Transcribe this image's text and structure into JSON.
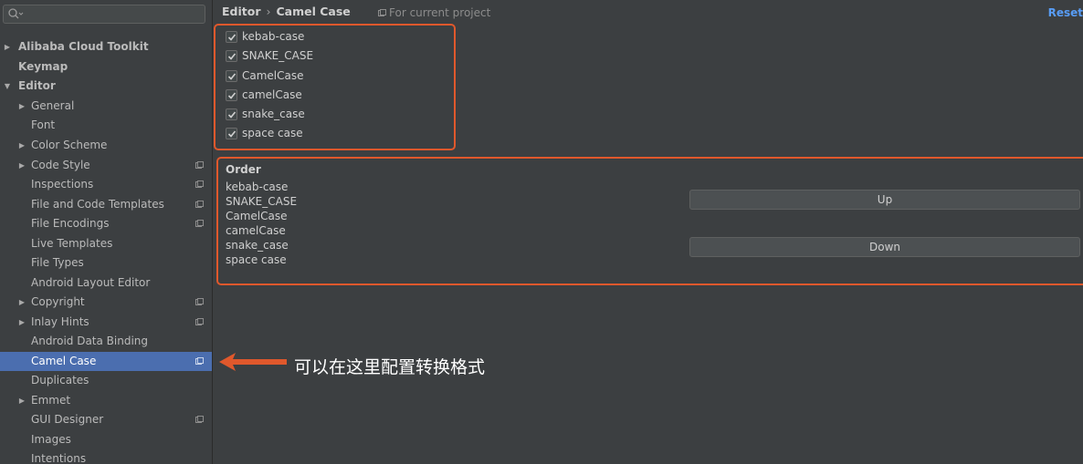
{
  "sidebar": {
    "items": [
      {
        "label": "Alibaba Cloud Toolkit",
        "arrow": "▶"
      },
      {
        "label": "Keymap",
        "arrow": ""
      },
      {
        "label": "Editor",
        "arrow": "▼"
      },
      {
        "label": "General",
        "arrow": "▶"
      },
      {
        "label": "Font",
        "arrow": ""
      },
      {
        "label": "Color Scheme",
        "arrow": "▶"
      },
      {
        "label": "Code Style",
        "arrow": "▶"
      },
      {
        "label": "Inspections",
        "arrow": ""
      },
      {
        "label": "File and Code Templates",
        "arrow": ""
      },
      {
        "label": "File Encodings",
        "arrow": ""
      },
      {
        "label": "Live Templates",
        "arrow": ""
      },
      {
        "label": "File Types",
        "arrow": ""
      },
      {
        "label": "Android Layout Editor",
        "arrow": ""
      },
      {
        "label": "Copyright",
        "arrow": "▶"
      },
      {
        "label": "Inlay Hints",
        "arrow": "▶"
      },
      {
        "label": "Android Data Binding",
        "arrow": ""
      },
      {
        "label": "Camel Case",
        "arrow": ""
      },
      {
        "label": "Duplicates",
        "arrow": ""
      },
      {
        "label": "Emmet",
        "arrow": "▶"
      },
      {
        "label": "GUI Designer",
        "arrow": ""
      },
      {
        "label": "Images",
        "arrow": ""
      },
      {
        "label": "Intentions",
        "arrow": ""
      }
    ]
  },
  "header": {
    "crumb_parent": "Editor",
    "crumb_sep": "›",
    "crumb_current": "Camel Case",
    "scope": "For current project",
    "reset": "Reset"
  },
  "options": [
    {
      "label": "kebab-case",
      "checked": true
    },
    {
      "label": "SNAKE_CASE",
      "checked": true
    },
    {
      "label": "CamelCase",
      "checked": true
    },
    {
      "label": "camelCase",
      "checked": true
    },
    {
      "label": "snake_case",
      "checked": true
    },
    {
      "label": "space case",
      "checked": true
    }
  ],
  "order": {
    "title": "Order",
    "items": [
      "kebab-case",
      "SNAKE_CASE",
      "CamelCase",
      "camelCase",
      "snake_case",
      "space case"
    ],
    "up_label": "Up",
    "down_label": "Down"
  },
  "annotation": {
    "text": "可以在这里配置转换格式",
    "color": "#e0582c"
  },
  "colors": {
    "accent": "#4b6eaf",
    "highlight_border": "#e0582c",
    "link": "#589df6"
  }
}
